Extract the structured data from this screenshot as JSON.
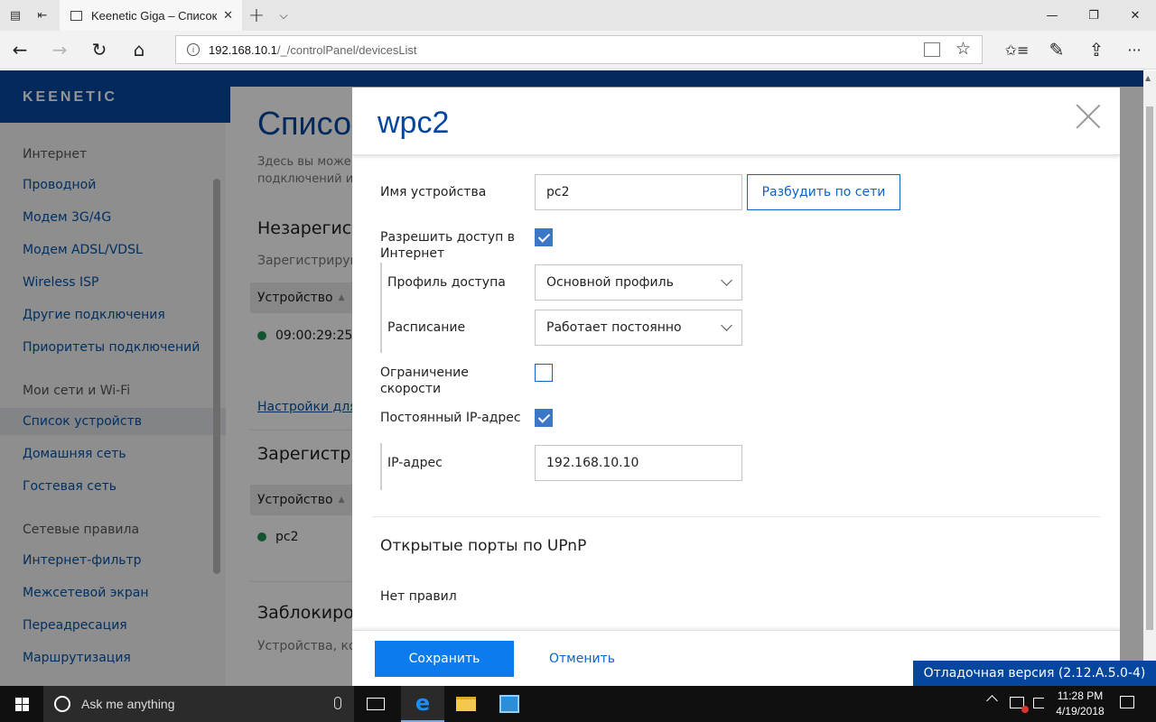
{
  "browser": {
    "tab_title": "Keenetic Giga – Список",
    "tab_close": "✕",
    "new_tab": "+",
    "tab_list": "⌵",
    "win_minimize": "—",
    "win_restore": "❐",
    "win_close": "✕",
    "back": "←",
    "forward": "→",
    "refresh": "↻",
    "home": "⌂",
    "address_host": "192.168.10.1",
    "address_path": "/_/controlPanel/devicesList",
    "favorite": "☆",
    "favorites_hub": "✩≡",
    "notes": "✎",
    "share": "⇪",
    "more": "···"
  },
  "brand": {
    "logo": "KEENETIC",
    "header_color": "#05479f"
  },
  "sidebar": {
    "groups": [
      "Интернет",
      "Мои сети и Wi-Fi",
      "Сетевые правила"
    ],
    "internet": [
      "Проводной",
      "Модем 3G/4G",
      "Модем ADSL/VDSL",
      "Wireless ISP",
      "Другие подключения",
      "Приоритеты подключений"
    ],
    "networks": [
      "Список устройств",
      "Домашняя сеть",
      "Гостевая сеть"
    ],
    "rules": [
      "Интернет-фильтр",
      "Межсетевой экран",
      "Переадресация",
      "Маршрутизация"
    ],
    "active_item": "Список устройств"
  },
  "main": {
    "title": "Список",
    "intro_line1": "Здесь вы може",
    "intro_line2": "подключений и",
    "section_unregistered": "Незарегист",
    "unregistered_hint": "Зарегистрируй",
    "col_device": "Устройство",
    "unregistered_row": "09:00:29:25",
    "settings_link": "Настройки для",
    "section_registered": "Зарегистри",
    "registered_row": "pc2",
    "section_blocked": "Заблокиров",
    "blocked_hint": "Устройства, ко"
  },
  "modal": {
    "title": "wpc2",
    "device_name_label": "Имя устройства",
    "device_name_value": "pc2",
    "wake_button": "Разбудить по сети",
    "allow_internet_label": "Разрешить доступ в Интернет",
    "allow_internet_checked": true,
    "access_profile_label": "Профиль доступа",
    "access_profile_value": "Основной профиль",
    "schedule_label": "Расписание",
    "schedule_value": "Работает постоянно",
    "speed_limit_label": "Ограничение скорости",
    "speed_limit_checked": false,
    "static_ip_label": "Постоянный IP-адрес",
    "static_ip_checked": true,
    "ip_label": "IP-адрес",
    "ip_value": "192.168.10.10",
    "upnp_title": "Открытые порты по UPnP",
    "upnp_empty": "Нет правил",
    "save_button": "Сохранить",
    "cancel_button": "Отменить"
  },
  "debug_badge": "Отладочная версия (2.12.A.5.0-4)",
  "taskbar": {
    "search_placeholder": "Ask me anything",
    "time": "11:28 PM",
    "date": "4/19/2018"
  },
  "colors": {
    "accent": "#0c7bee",
    "link": "#0553a6",
    "online_dot": "#1f8f54"
  }
}
